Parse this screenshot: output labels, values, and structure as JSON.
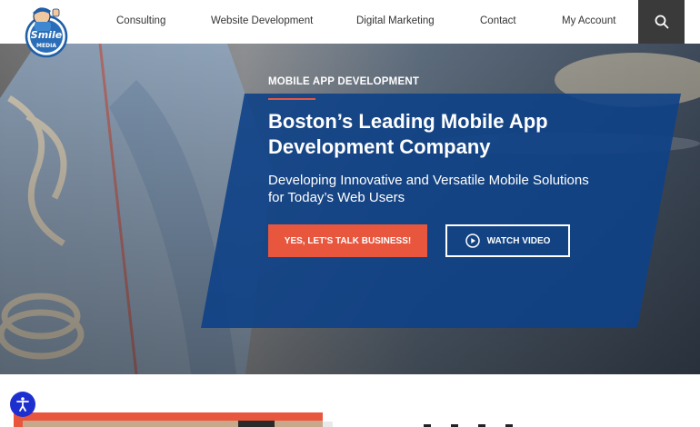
{
  "header": {
    "logo_alt": "Smile Media",
    "nav": [
      {
        "label": "Consulting"
      },
      {
        "label": "Website Development"
      },
      {
        "label": "Digital Marketing"
      },
      {
        "label": "Contact"
      },
      {
        "label": "My Account"
      }
    ],
    "search_icon": "search-icon"
  },
  "hero": {
    "eyebrow": "MOBILE APP DEVELOPMENT",
    "headline": "Boston’s Leading Mobile App Development Company",
    "subhead": "Developing Innovative and Versatile Mobile Solutions for Today’s Web Users",
    "primary_cta": "YES, LET'S TALK BUSINESS!",
    "video_cta": "WATCH VIDEO",
    "video_icon": "play-circle-icon"
  },
  "colors": {
    "panel": "#0e4187",
    "accent": "#e8563e",
    "search_bg": "#3a3a3a",
    "accessibility": "#1e2fd0"
  },
  "accessibility": {
    "icon": "accessibility-icon"
  }
}
